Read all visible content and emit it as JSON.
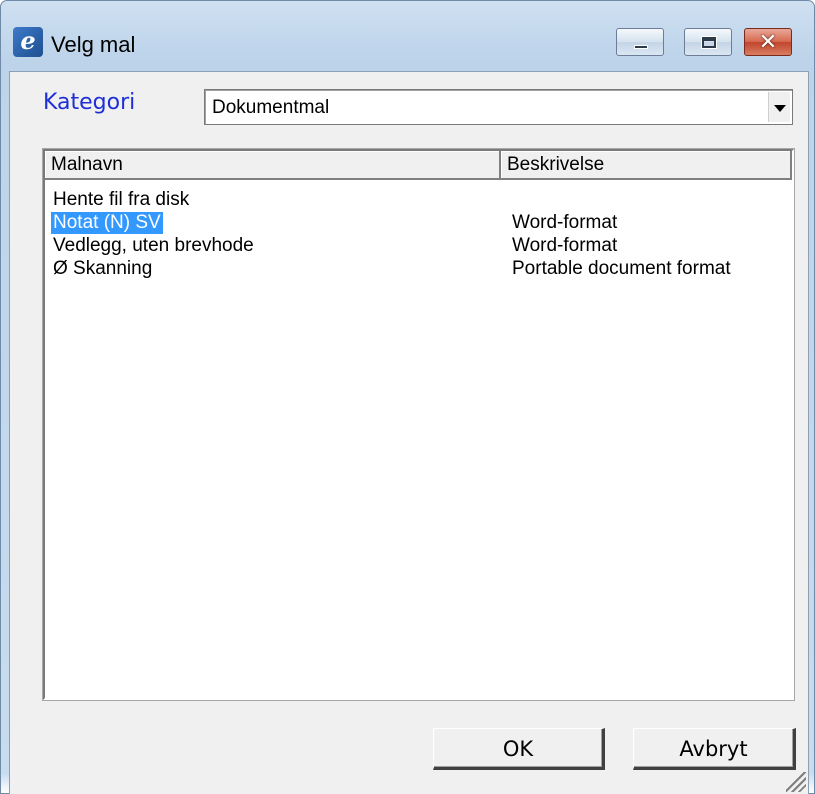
{
  "window": {
    "title": "Velg mal",
    "icon": "e-logo-icon",
    "controls": [
      "minimize-icon",
      "maximize-icon",
      "close-icon"
    ]
  },
  "kategori": {
    "label": "Kategori",
    "selected": "Dokumentmal"
  },
  "list": {
    "columns": [
      "Malnavn",
      "Beskrivelse"
    ],
    "rows": [
      {
        "name": "Hente fil fra disk",
        "description": "",
        "selected": false
      },
      {
        "name": "Notat (N) SV",
        "description": "Word-format",
        "selected": true
      },
      {
        "name": "Vedlegg, uten brevhode",
        "description": "Word-format",
        "selected": false
      },
      {
        "name": "Ø Skanning",
        "description": "Portable document format",
        "selected": false
      }
    ]
  },
  "buttons": {
    "ok": "OK",
    "cancel": "Avbryt"
  },
  "colors": {
    "label_blue": "#1e2fd6",
    "selection": "#3399ff"
  }
}
